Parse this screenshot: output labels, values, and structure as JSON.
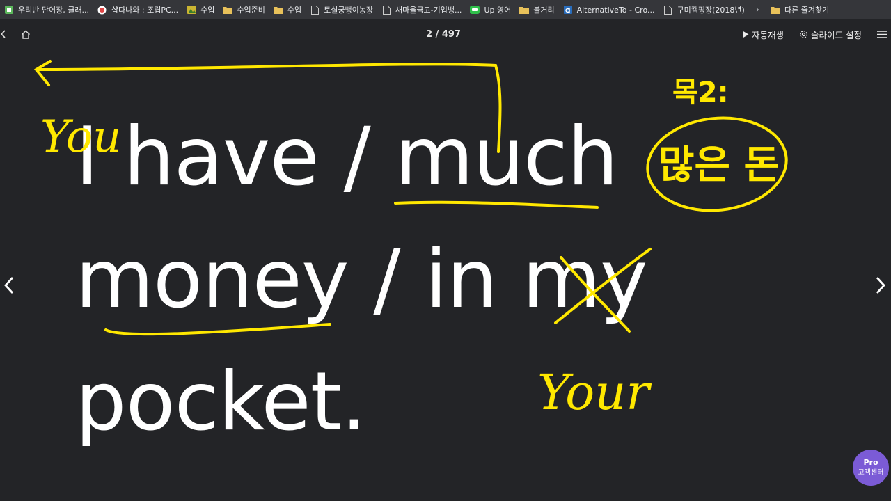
{
  "bookmarks": [
    {
      "label": "우리반 단어장, 클래...",
      "icon": "green-square-icon",
      "color": "#5cb85c"
    },
    {
      "label": "샵다나와 : 조립PC...",
      "icon": "shop-logo-icon",
      "color": "#e04646"
    },
    {
      "label": "수업",
      "icon": "image-icon",
      "color": "#cbb532"
    },
    {
      "label": "수업준비",
      "icon": "folder-icon",
      "color": "#e8c15a"
    },
    {
      "label": "수업",
      "icon": "folder-icon",
      "color": "#e8c15a"
    },
    {
      "label": "토실궁뱅이농장",
      "icon": "page-icon",
      "color": "#cccccc"
    },
    {
      "label": "새마을금고-기업뱅...",
      "icon": "page-icon",
      "color": "#cccccc"
    },
    {
      "label": "Up 영어",
      "icon": "line-logo-icon",
      "color": "#2fbf4a"
    },
    {
      "label": "볼거리",
      "icon": "folder-icon",
      "color": "#e8c15a"
    },
    {
      "label": "AlternativeTo - Cro...",
      "icon": "alternativeto-logo-icon",
      "color": "#2a6ebd"
    },
    {
      "label": "구미캠핑장(2018년)",
      "icon": "page-icon",
      "color": "#cccccc"
    }
  ],
  "bookmarks_more": "›",
  "other_bookmarks": "다른 즐겨찾기",
  "topbar": {
    "counter": "2 / 497",
    "autoplay": "자동재생",
    "slide_settings": "슬라이드 설정"
  },
  "slide": {
    "lines": [
      "I have / much",
      "money / in my",
      "pocket."
    ]
  },
  "annotations": {
    "you": "You",
    "your": "Your",
    "note_top": "목2:",
    "note_circle": "많은 돈"
  },
  "pro_badge": {
    "title": "Pro",
    "subtitle": "고객센터",
    "color": "#7b5bd6"
  },
  "colors": {
    "background": "#232427",
    "bookmark_bar": "#35363a",
    "ink": "#ffe800"
  }
}
